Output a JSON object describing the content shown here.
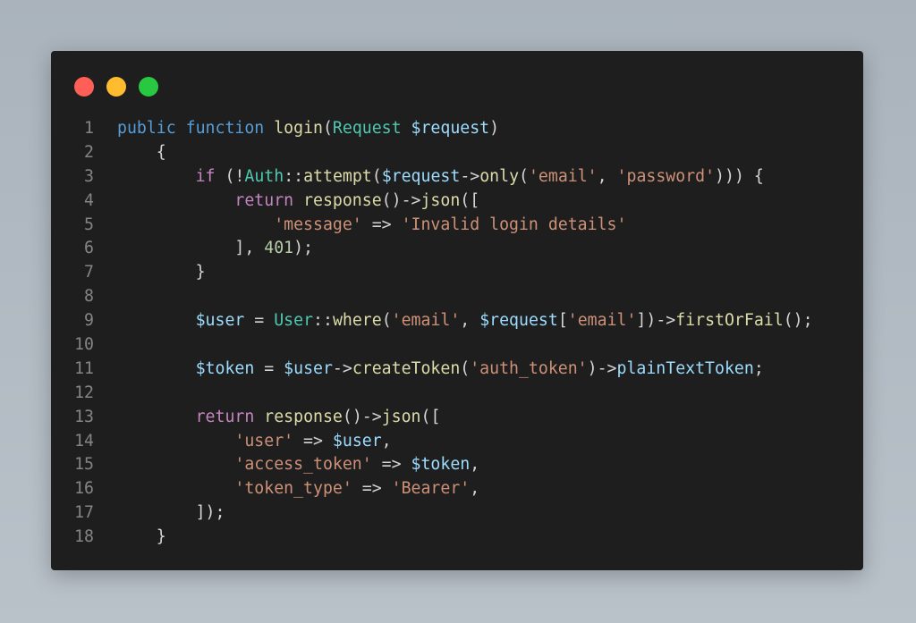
{
  "window": {
    "controls": [
      {
        "name": "close",
        "color": "#ff5f57"
      },
      {
        "name": "minimize",
        "color": "#febc2e"
      },
      {
        "name": "maximize",
        "color": "#28c840"
      }
    ],
    "background": "#1e1e1e"
  },
  "code": {
    "language": "php",
    "lines": [
      {
        "number": "1",
        "tokens": [
          [
            "k",
            "public "
          ],
          [
            "k",
            "function "
          ],
          [
            "f",
            "login"
          ],
          [
            "p",
            "("
          ],
          [
            "t",
            "Request "
          ],
          [
            "v",
            "$request"
          ],
          [
            "p",
            ")"
          ]
        ]
      },
      {
        "number": "2",
        "tokens": [
          [
            "p",
            "    {"
          ]
        ]
      },
      {
        "number": "3",
        "tokens": [
          [
            "p",
            "        "
          ],
          [
            "c",
            "if "
          ],
          [
            "p",
            "(!"
          ],
          [
            "t",
            "Auth"
          ],
          [
            "p",
            "::"
          ],
          [
            "f",
            "attempt"
          ],
          [
            "p",
            "("
          ],
          [
            "v",
            "$request"
          ],
          [
            "p",
            "->"
          ],
          [
            "f",
            "only"
          ],
          [
            "p",
            "("
          ],
          [
            "s",
            "'email'"
          ],
          [
            "p",
            ", "
          ],
          [
            "s",
            "'password'"
          ],
          [
            "p",
            "))) {"
          ]
        ]
      },
      {
        "number": "4",
        "tokens": [
          [
            "p",
            "            "
          ],
          [
            "c",
            "return "
          ],
          [
            "f",
            "response"
          ],
          [
            "p",
            "()->"
          ],
          [
            "f",
            "json"
          ],
          [
            "p",
            "(["
          ]
        ]
      },
      {
        "number": "5",
        "tokens": [
          [
            "p",
            "                "
          ],
          [
            "s",
            "'message'"
          ],
          [
            "p",
            " => "
          ],
          [
            "s",
            "'Invalid login details'"
          ]
        ]
      },
      {
        "number": "6",
        "tokens": [
          [
            "p",
            "            ], "
          ],
          [
            "n",
            "401"
          ],
          [
            "p",
            ");"
          ]
        ]
      },
      {
        "number": "7",
        "tokens": [
          [
            "p",
            "        }"
          ]
        ]
      },
      {
        "number": "8",
        "tokens": []
      },
      {
        "number": "9",
        "tokens": [
          [
            "p",
            "        "
          ],
          [
            "v",
            "$user"
          ],
          [
            "p",
            " = "
          ],
          [
            "t",
            "User"
          ],
          [
            "p",
            "::"
          ],
          [
            "f",
            "where"
          ],
          [
            "p",
            "("
          ],
          [
            "s",
            "'email'"
          ],
          [
            "p",
            ", "
          ],
          [
            "v",
            "$request"
          ],
          [
            "p",
            "["
          ],
          [
            "s",
            "'email'"
          ],
          [
            "p",
            "])->"
          ],
          [
            "f",
            "firstOrFail"
          ],
          [
            "p",
            "();"
          ]
        ]
      },
      {
        "number": "10",
        "tokens": []
      },
      {
        "number": "11",
        "tokens": [
          [
            "p",
            "        "
          ],
          [
            "v",
            "$token"
          ],
          [
            "p",
            " = "
          ],
          [
            "v",
            "$user"
          ],
          [
            "p",
            "->"
          ],
          [
            "f",
            "createToken"
          ],
          [
            "p",
            "("
          ],
          [
            "s",
            "'auth_token'"
          ],
          [
            "p",
            ")->"
          ],
          [
            "v",
            "plainTextToken"
          ],
          [
            "p",
            ";"
          ]
        ]
      },
      {
        "number": "12",
        "tokens": []
      },
      {
        "number": "13",
        "tokens": [
          [
            "p",
            "        "
          ],
          [
            "c",
            "return "
          ],
          [
            "f",
            "response"
          ],
          [
            "p",
            "()->"
          ],
          [
            "f",
            "json"
          ],
          [
            "p",
            "(["
          ]
        ]
      },
      {
        "number": "14",
        "tokens": [
          [
            "p",
            "            "
          ],
          [
            "s",
            "'user'"
          ],
          [
            "p",
            " => "
          ],
          [
            "v",
            "$user"
          ],
          [
            "p",
            ","
          ]
        ]
      },
      {
        "number": "15",
        "tokens": [
          [
            "p",
            "            "
          ],
          [
            "s",
            "'access_token'"
          ],
          [
            "p",
            " => "
          ],
          [
            "v",
            "$token"
          ],
          [
            "p",
            ","
          ]
        ]
      },
      {
        "number": "16",
        "tokens": [
          [
            "p",
            "            "
          ],
          [
            "s",
            "'token_type'"
          ],
          [
            "p",
            " => "
          ],
          [
            "s",
            "'Bearer'"
          ],
          [
            "p",
            ","
          ]
        ]
      },
      {
        "number": "17",
        "tokens": [
          [
            "p",
            "        ]);"
          ]
        ]
      },
      {
        "number": "18",
        "tokens": [
          [
            "p",
            "    }"
          ]
        ]
      }
    ]
  }
}
